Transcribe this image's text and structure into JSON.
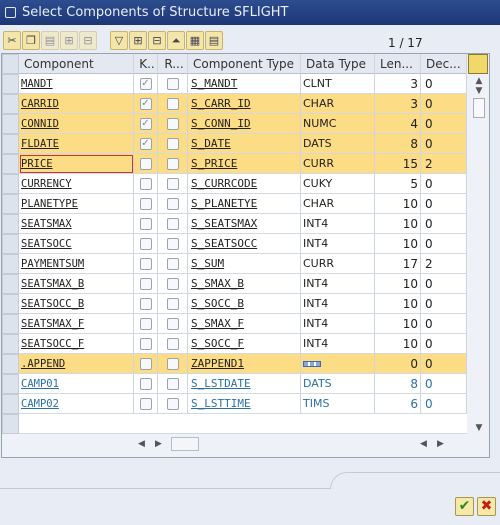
{
  "window": {
    "title": "Select Components of Structure SFLIGHT"
  },
  "toolbar": {
    "icons": [
      "cut-icon",
      "copy-icon",
      "paste-icon",
      "insert-row-icon",
      "delete-row-icon",
      "select-all-icon",
      "expand-icon",
      "collapse-icon",
      "sort-icon",
      "layout-icon",
      "details-icon"
    ]
  },
  "pager": {
    "text": "1 / 17"
  },
  "table": {
    "headers": [
      "Component",
      "K..",
      "R...",
      "Component Type",
      "Data Type",
      "Len...",
      "Dec..."
    ],
    "rows": [
      {
        "component": "MANDT",
        "key": true,
        "req": false,
        "type": "S_MANDT",
        "dtype": "CLNT",
        "len": "3",
        "dec": "0",
        "hl": false
      },
      {
        "component": "CARRID",
        "key": true,
        "req": false,
        "type": "S_CARR_ID",
        "dtype": "CHAR",
        "len": "3",
        "dec": "0",
        "hl": true
      },
      {
        "component": "CONNID",
        "key": true,
        "req": false,
        "type": "S_CONN_ID",
        "dtype": "NUMC",
        "len": "4",
        "dec": "0",
        "hl": true
      },
      {
        "component": "FLDATE",
        "key": true,
        "req": false,
        "type": "S_DATE",
        "dtype": "DATS",
        "len": "8",
        "dec": "0",
        "hl": true
      },
      {
        "component": "PRICE",
        "key": false,
        "req": false,
        "type": "S_PRICE",
        "dtype": "CURR",
        "len": "15",
        "dec": "2",
        "hl": true,
        "focus": true
      },
      {
        "component": "CURRENCY",
        "key": false,
        "req": false,
        "type": "S_CURRCODE",
        "dtype": "CUKY",
        "len": "5",
        "dec": "0",
        "hl": false
      },
      {
        "component": "PLANETYPE",
        "key": false,
        "req": false,
        "type": "S_PLANETYE",
        "dtype": "CHAR",
        "len": "10",
        "dec": "0",
        "hl": false
      },
      {
        "component": "SEATSMAX",
        "key": false,
        "req": false,
        "type": "S_SEATSMAX",
        "dtype": "INT4",
        "len": "10",
        "dec": "0",
        "hl": false
      },
      {
        "component": "SEATSOCC",
        "key": false,
        "req": false,
        "type": "S_SEATSOCC",
        "dtype": "INT4",
        "len": "10",
        "dec": "0",
        "hl": false
      },
      {
        "component": "PAYMENTSUM",
        "key": false,
        "req": false,
        "type": "S_SUM",
        "dtype": "CURR",
        "len": "17",
        "dec": "2",
        "hl": false
      },
      {
        "component": "SEATSMAX_B",
        "key": false,
        "req": false,
        "type": "S_SMAX_B",
        "dtype": "INT4",
        "len": "10",
        "dec": "0",
        "hl": false
      },
      {
        "component": "SEATSOCC_B",
        "key": false,
        "req": false,
        "type": "S_SOCC_B",
        "dtype": "INT4",
        "len": "10",
        "dec": "0",
        "hl": false
      },
      {
        "component": "SEATSMAX_F",
        "key": false,
        "req": false,
        "type": "S_SMAX_F",
        "dtype": "INT4",
        "len": "10",
        "dec": "0",
        "hl": false
      },
      {
        "component": "SEATSOCC_F",
        "key": false,
        "req": false,
        "type": "S_SOCC_F",
        "dtype": "INT4",
        "len": "10",
        "dec": "0",
        "hl": false
      },
      {
        "component": ".APPEND",
        "key": false,
        "req": false,
        "type": "ZAPPEND1",
        "dtype": "",
        "len": "0",
        "dec": "0",
        "hl": true,
        "structIcon": true
      },
      {
        "component": "CAMP01",
        "key": false,
        "req": false,
        "type": "S_LSTDATE",
        "dtype": "DATS",
        "len": "8",
        "dec": "0",
        "hl": false,
        "blue": true
      },
      {
        "component": "CAMP02",
        "key": false,
        "req": false,
        "type": "S_LSTTIME",
        "dtype": "TIMS",
        "len": "6",
        "dec": "0",
        "hl": false,
        "blue": true
      }
    ]
  },
  "footer": {
    "confirm_icon": "checkmark-icon",
    "cancel_icon": "cancel-icon"
  },
  "colors": {
    "highlight": "#fddc86",
    "titlebar": "#1d3775",
    "link_blue": "#2a6fa8"
  }
}
